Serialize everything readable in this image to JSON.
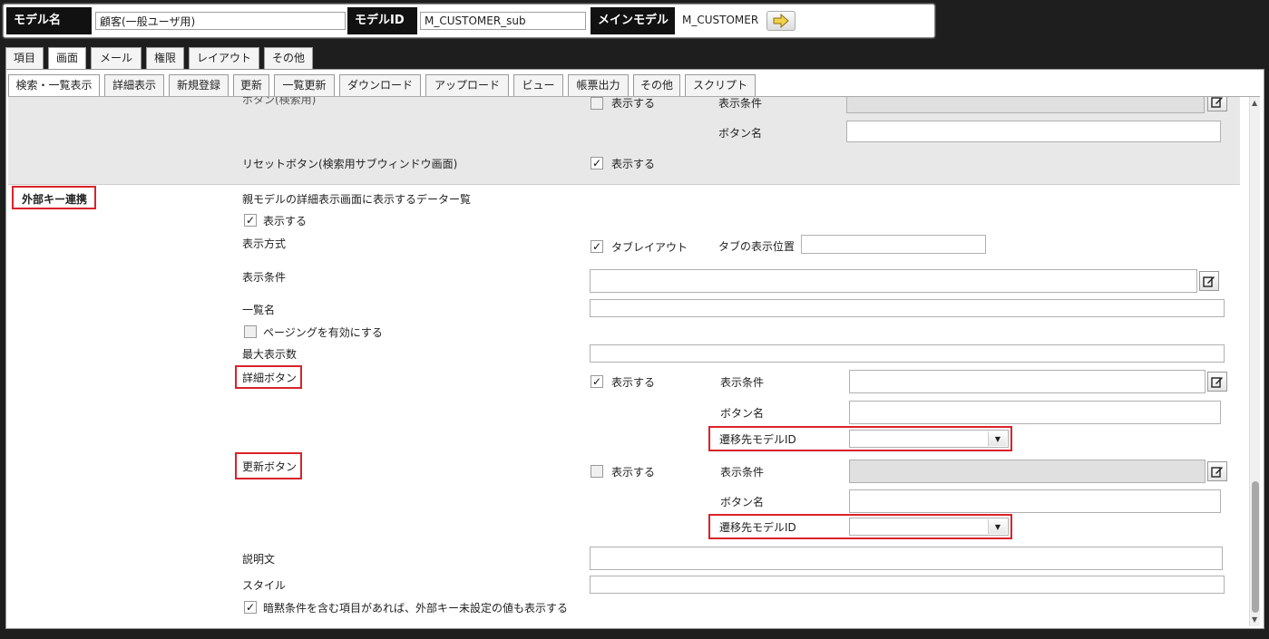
{
  "header": {
    "model_name_label": "モデル名",
    "model_name_value": "顧客(一般ユーザ用)",
    "model_id_label": "モデルID",
    "model_id_value": "M_CUSTOMER_sub",
    "main_model_label": "メインモデル",
    "main_model_value": "M_CUSTOMER"
  },
  "tabs_primary": [
    "項目",
    "画面",
    "メール",
    "権限",
    "レイアウト",
    "その他"
  ],
  "tabs_secondary": [
    "検索・一覧表示",
    "詳細表示",
    "新規登録",
    "更新",
    "一覧更新",
    "ダウンロード",
    "アップロード",
    "ビュー",
    "帳票出力",
    "その他",
    "スクリプト"
  ],
  "top_section": {
    "partial_label": "ボタン(検索用)",
    "show_label": "表示する",
    "display_condition_label": "表示条件",
    "button_name_label": "ボタン名",
    "reset_button_label": "リセットボタン(検索用サブウィンドウ画面)",
    "reset_show_label": "表示する"
  },
  "fk_section": {
    "section_label": "外部キー連携",
    "parent_list_label": "親モデルの詳細表示画面に表示するデーター覧",
    "show_label": "表示する",
    "display_method_label": "表示方式",
    "tab_layout_label": "タブレイアウト",
    "tab_position_label": "タブの表示位置",
    "display_condition_label": "表示条件",
    "list_name_label": "一覧名",
    "paging_label": "ページングを有効にする",
    "max_display_label": "最大表示数",
    "detail_button": {
      "label": "詳細ボタン",
      "show_label": "表示する",
      "condition_label": "表示条件",
      "button_name_label": "ボタン名",
      "dest_model_label": "遷移先モデルID"
    },
    "update_button": {
      "label": "更新ボタン",
      "show_label": "表示する",
      "condition_label": "表示条件",
      "button_name_label": "ボタン名",
      "dest_model_label": "遷移先モデルID"
    },
    "description_label": "説明文",
    "style_label": "スタイル",
    "implicit_label": "暗黙条件を含む項目があれば、外部キー未設定の値も表示する"
  },
  "colors": {
    "highlight": "#d9232a",
    "header_bg": "#111111",
    "page_bg": "#1e1e1e"
  }
}
